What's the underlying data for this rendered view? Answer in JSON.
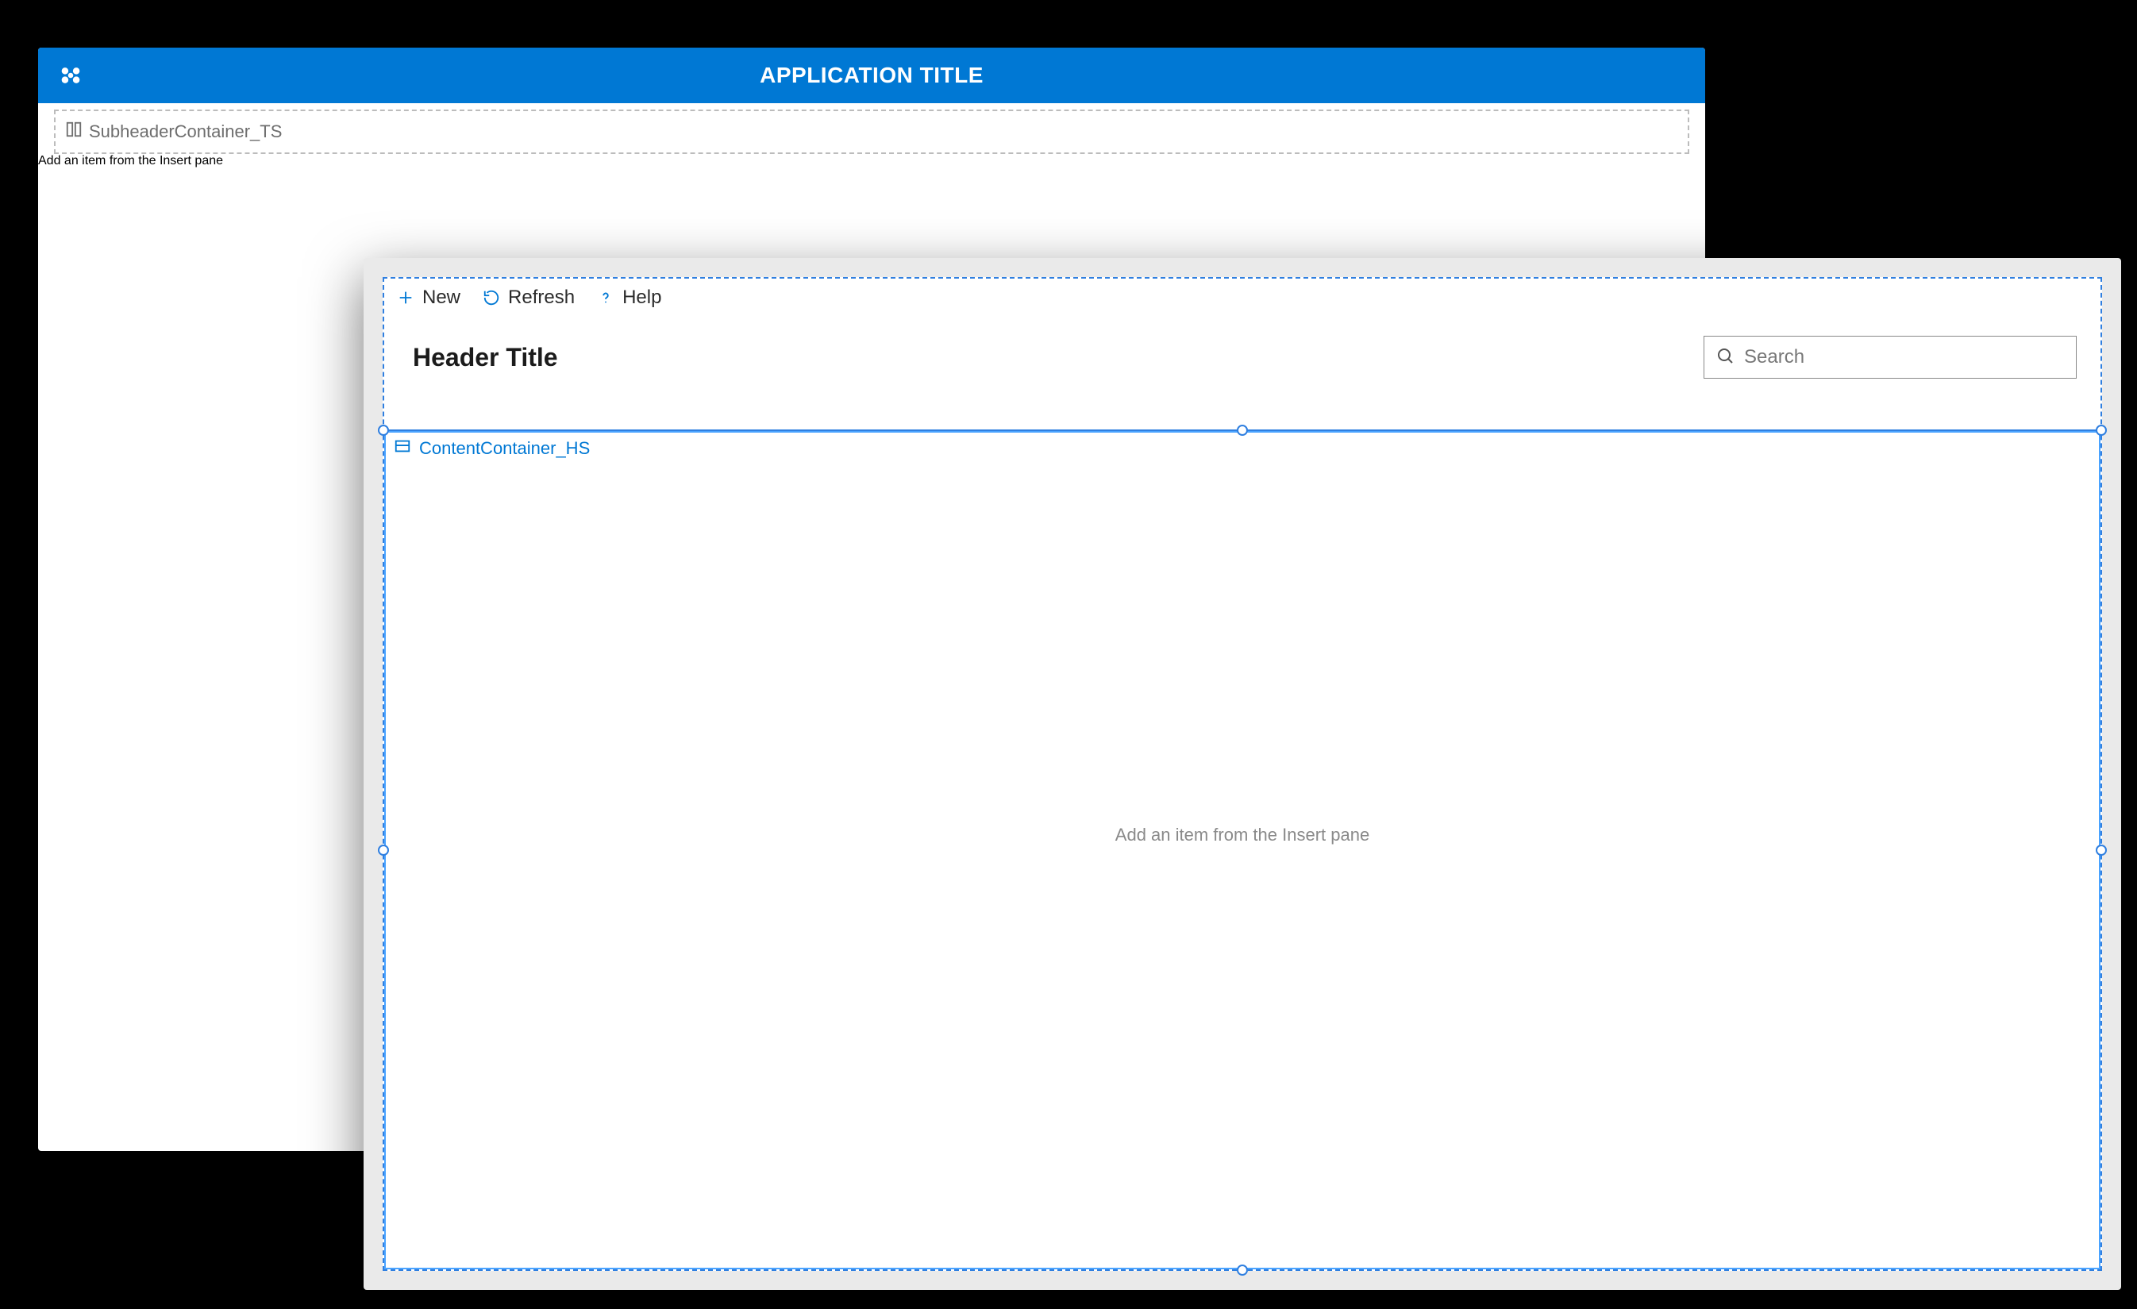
{
  "colors": {
    "brand": "#0078d4"
  },
  "back": {
    "title": "APPLICATION TITLE",
    "subheader_name": "SubheaderContainer_TS",
    "subheader_hint": "Add an item from the Insert pane"
  },
  "front": {
    "commands": {
      "new": "New",
      "refresh": "Refresh",
      "help": "Help"
    },
    "header_title": "Header Title",
    "search_placeholder": "Search",
    "content_name": "ContentContainer_HS",
    "content_hint": "Add an item from the Insert pane"
  }
}
